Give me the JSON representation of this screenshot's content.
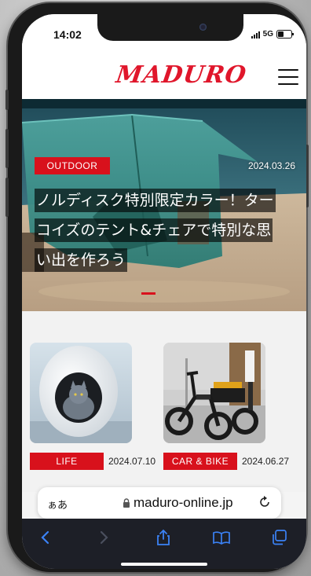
{
  "status": {
    "time": "14:02",
    "network": "5G"
  },
  "site": {
    "logo": "MADURO",
    "brand_color": "#e0162b",
    "menu_icon": "hamburger-menu-icon"
  },
  "hero": {
    "category": "OUTDOOR",
    "date": "2024.03.26",
    "title": "ノルディスク特別限定カラー！ターコイズのテント&チェアで特別な思い出を作ろう",
    "slider_active": 1
  },
  "cards": [
    {
      "category": "LIFE",
      "date": "2024.07.10",
      "image": "white-pet-bed-with-grey-cat"
    },
    {
      "category": "CAR & BIKE",
      "date": "2024.06.27",
      "image": "black-electric-trike"
    }
  ],
  "address_bar": {
    "text_size": "ぁあ",
    "url": "maduro-online.jp"
  },
  "toolbar": {
    "icons": [
      "back-icon",
      "forward-icon",
      "share-icon",
      "bookmarks-icon",
      "tabs-icon"
    ]
  },
  "colors": {
    "tag_red": "#d8111c",
    "toolbar_bg": "#1d1f27",
    "toolbar_icon": "#3b82f6"
  }
}
